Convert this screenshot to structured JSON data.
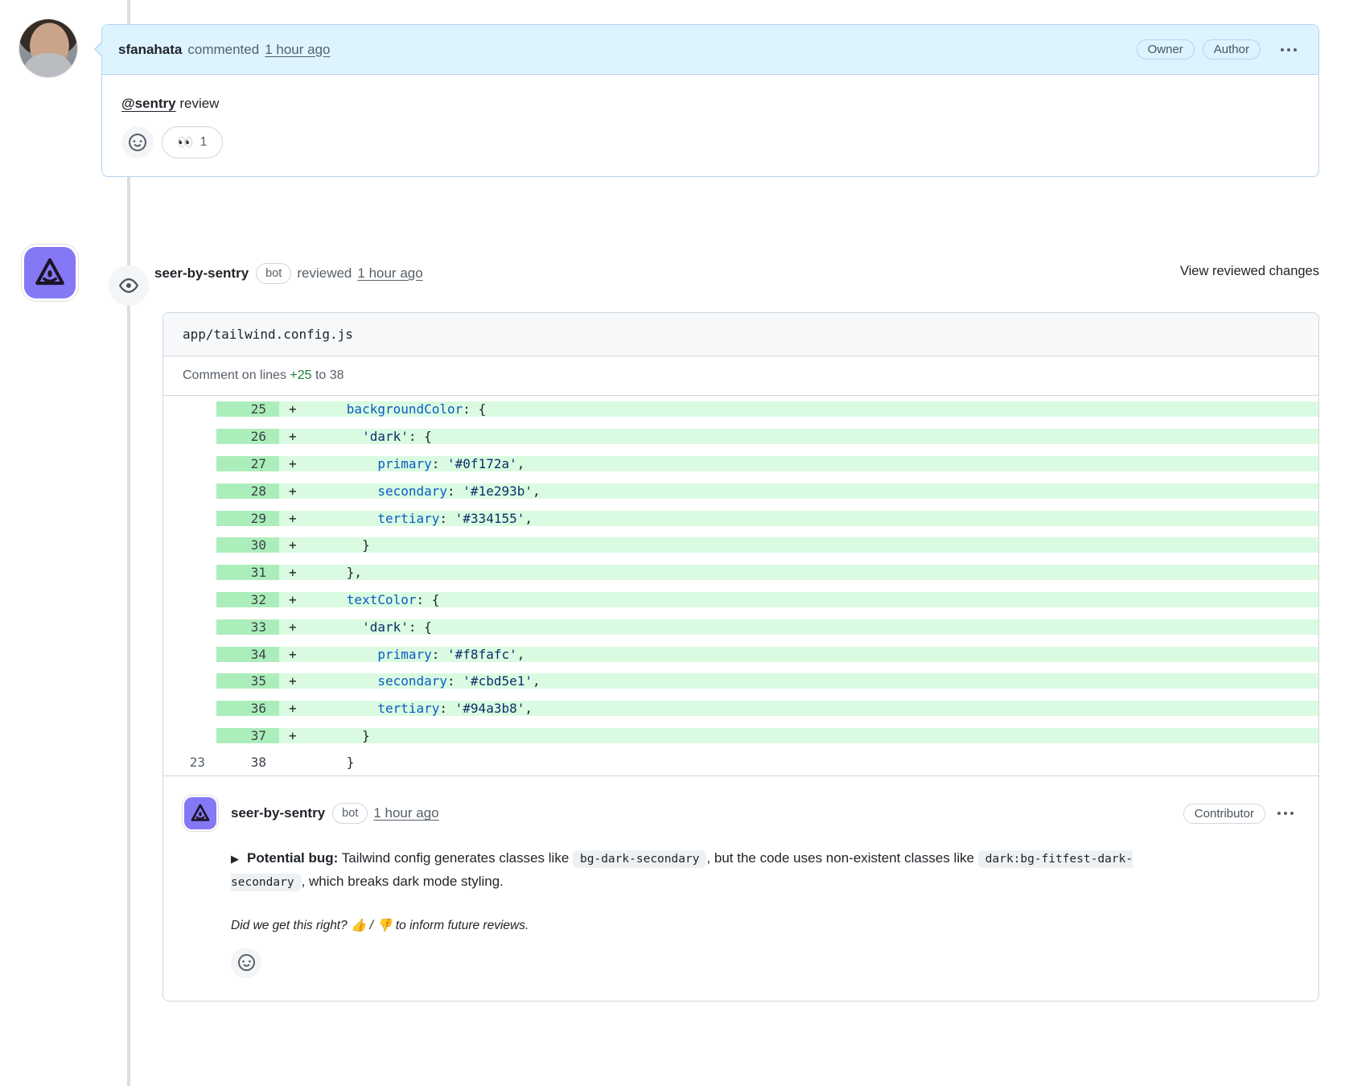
{
  "colors": {
    "header_blue": "#ddf4ff",
    "card_border_blue": "#b3d5f2",
    "border": "#d0d7de",
    "muted": "#57606a",
    "dark": "#1f2328",
    "green": "#1a7f37",
    "gutter_green": "#aceebb",
    "add_bg": "#dafbe1",
    "key_blue": "#0a5bc4",
    "str_navy": "#0a3069",
    "purple": "#8578f4",
    "timeline": "#d8dee4",
    "chip_bg": "#eef1f4",
    "circle_bg": "#f3f5f7"
  },
  "top_comment": {
    "author": "sfanahata",
    "action": "commented",
    "time": "1 hour ago",
    "badges": [
      "Owner",
      "Author"
    ],
    "body_mention": "@sentry",
    "body_rest": " review",
    "reaction_emoji": "👀",
    "reaction_count": "1"
  },
  "review": {
    "author": "seer-by-sentry",
    "bot_label": "bot",
    "action": "reviewed",
    "time": "1 hour ago",
    "view_link": "View reviewed changes"
  },
  "diff": {
    "file_path": "app/tailwind.config.js",
    "comment_prefix": "Comment on lines ",
    "range_start": "+25",
    "range_mid": " to ",
    "range_end": "38",
    "rows": [
      {
        "old": "",
        "new": "25",
        "marker": "+",
        "type": "add",
        "segs": [
          [
            "      ",
            "p"
          ],
          [
            "backgroundColor",
            "k"
          ],
          [
            ": {",
            "p"
          ]
        ]
      },
      {
        "old": "",
        "new": "26",
        "marker": "+",
        "type": "add",
        "segs": [
          [
            "        ",
            "p"
          ],
          [
            "'dark'",
            "s"
          ],
          [
            ": {",
            "p"
          ]
        ]
      },
      {
        "old": "",
        "new": "27",
        "marker": "+",
        "type": "add",
        "segs": [
          [
            "          ",
            "p"
          ],
          [
            "primary",
            "k"
          ],
          [
            ": ",
            "p"
          ],
          [
            "'#0f172a'",
            "s"
          ],
          [
            ",",
            "p"
          ]
        ]
      },
      {
        "old": "",
        "new": "28",
        "marker": "+",
        "type": "add",
        "segs": [
          [
            "          ",
            "p"
          ],
          [
            "secondary",
            "k"
          ],
          [
            ": ",
            "p"
          ],
          [
            "'#1e293b'",
            "s"
          ],
          [
            ",",
            "p"
          ]
        ]
      },
      {
        "old": "",
        "new": "29",
        "marker": "+",
        "type": "add",
        "segs": [
          [
            "          ",
            "p"
          ],
          [
            "tertiary",
            "k"
          ],
          [
            ": ",
            "p"
          ],
          [
            "'#334155'",
            "s"
          ],
          [
            ",",
            "p"
          ]
        ]
      },
      {
        "old": "",
        "new": "30",
        "marker": "+",
        "type": "add",
        "segs": [
          [
            "        }",
            "p"
          ]
        ]
      },
      {
        "old": "",
        "new": "31",
        "marker": "+",
        "type": "add",
        "segs": [
          [
            "      },",
            "p"
          ]
        ]
      },
      {
        "old": "",
        "new": "32",
        "marker": "+",
        "type": "add",
        "segs": [
          [
            "      ",
            "p"
          ],
          [
            "textColor",
            "k"
          ],
          [
            ": {",
            "p"
          ]
        ]
      },
      {
        "old": "",
        "new": "33",
        "marker": "+",
        "type": "add",
        "segs": [
          [
            "        ",
            "p"
          ],
          [
            "'dark'",
            "s"
          ],
          [
            ": {",
            "p"
          ]
        ]
      },
      {
        "old": "",
        "new": "34",
        "marker": "+",
        "type": "add",
        "segs": [
          [
            "          ",
            "p"
          ],
          [
            "primary",
            "k"
          ],
          [
            ": ",
            "p"
          ],
          [
            "'#f8fafc'",
            "s"
          ],
          [
            ",",
            "p"
          ]
        ]
      },
      {
        "old": "",
        "new": "35",
        "marker": "+",
        "type": "add",
        "segs": [
          [
            "          ",
            "p"
          ],
          [
            "secondary",
            "k"
          ],
          [
            ": ",
            "p"
          ],
          [
            "'#cbd5e1'",
            "s"
          ],
          [
            ",",
            "p"
          ]
        ]
      },
      {
        "old": "",
        "new": "36",
        "marker": "+",
        "type": "add",
        "segs": [
          [
            "          ",
            "p"
          ],
          [
            "tertiary",
            "k"
          ],
          [
            ": ",
            "p"
          ],
          [
            "'#94a3b8'",
            "s"
          ],
          [
            ",",
            "p"
          ]
        ]
      },
      {
        "old": "",
        "new": "37",
        "marker": "+",
        "type": "add",
        "segs": [
          [
            "        }",
            "p"
          ]
        ]
      },
      {
        "old": "23",
        "new": "38",
        "marker": "",
        "type": "ctx",
        "segs": [
          [
            "      }",
            "p"
          ]
        ]
      }
    ]
  },
  "inline_comment": {
    "author": "seer-by-sentry",
    "bot_label": "bot",
    "time": "1 hour ago",
    "badge": "Contributor",
    "disclosure": "▶",
    "title": "Potential bug:",
    "body": [
      {
        "t": " Tailwind config generates classes like ",
        "code": false
      },
      {
        "t": "bg-dark-secondary",
        "code": true
      },
      {
        "t": ", but the code uses non-existent classes like ",
        "code": false
      },
      {
        "t": "dark:bg-fitfest-dark-secondary",
        "code": true
      },
      {
        "t": ", which breaks dark mode styling.",
        "code": false
      }
    ],
    "footnote": "Did we get this right? 👍 / 👎 to inform future reviews."
  }
}
